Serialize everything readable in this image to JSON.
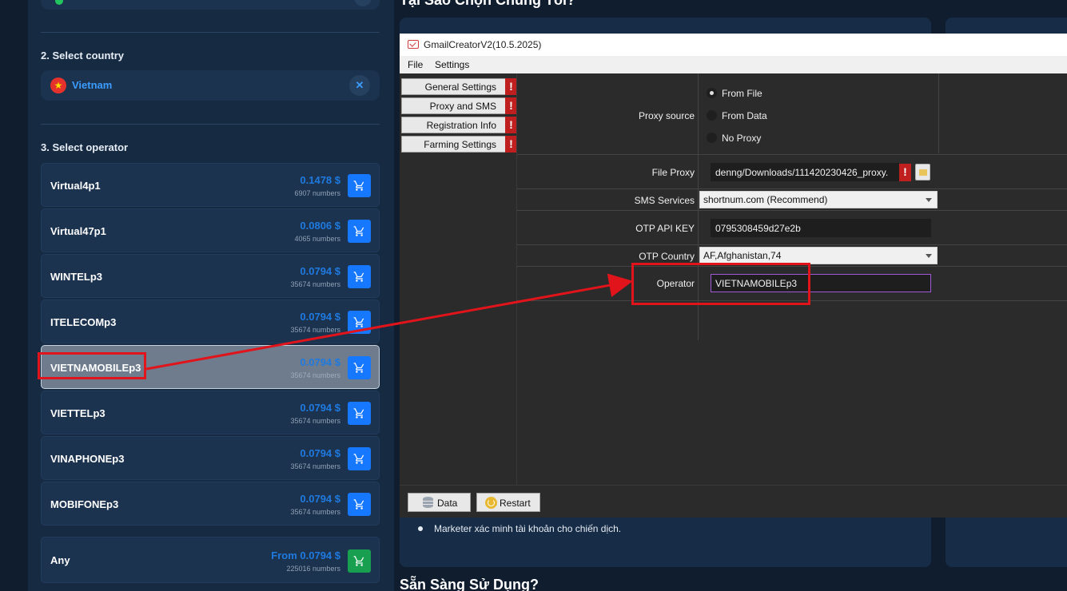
{
  "web": {
    "select_country_title": "2. Select country",
    "country": {
      "name": "Vietnam",
      "flag": "★",
      "clear": "✕"
    },
    "select_operator_title": "3. Select operator",
    "operators": [
      {
        "name": "Virtual4p1",
        "price": "0.1478 $",
        "count": "6907 numbers"
      },
      {
        "name": "Virtual47p1",
        "price": "0.0806 $",
        "count": "4065 numbers"
      },
      {
        "name": "WINTELp3",
        "price": "0.0794 $",
        "count": "35674 numbers"
      },
      {
        "name": "ITELECOMp3",
        "price": "0.0794 $",
        "count": "35674 numbers"
      },
      {
        "name": "VIETNAMOBILEp3",
        "price": "0.0794 $",
        "count": "35674 numbers",
        "selected": true
      },
      {
        "name": "VIETTELp3",
        "price": "0.0794 $",
        "count": "35674 numbers"
      },
      {
        "name": "VINAPHONEp3",
        "price": "0.0794 $",
        "count": "35674 numbers"
      },
      {
        "name": "MOBIFONEp3",
        "price": "0.0794 $",
        "count": "35674 numbers"
      }
    ],
    "any": {
      "name": "Any",
      "price": "From 0.0794 $",
      "count": "225016 numbers"
    },
    "heading_top": "Tại Sao Chọn Chúng Tôi?",
    "bullet": "Marketer xác minh tài khoản cho chiến dịch.",
    "heading_bottom": "Sẵn Sàng Sử Dụng?",
    "accent_color": "#1677ff"
  },
  "app": {
    "title": "GmailCreatorV2(10.5.2025)",
    "menu": [
      "File",
      "Settings"
    ],
    "nav": [
      "General Settings",
      "Proxy and SMS",
      "Registration Info",
      "Farming Settings"
    ],
    "warn_glyph": "!",
    "proxy_source_label": "Proxy source",
    "proxy_options": [
      "From File",
      "From Data",
      "No Proxy"
    ],
    "file_proxy_label": "File Proxy",
    "file_proxy_value": "denng/Downloads/111420230426_proxy.",
    "sms_label": "SMS Services",
    "sms_value": "shortnum.com (Recommend)",
    "otp_key_label": "OTP API KEY",
    "otp_key_value": "0795308459d27e2b",
    "otp_country_label": "OTP Country",
    "otp_country_value": "AF,Afghanistan,74",
    "operator_label": "Operator",
    "operator_value": "VIETNAMOBILEp3",
    "data_button": "Data",
    "restart_button": "Restart"
  }
}
